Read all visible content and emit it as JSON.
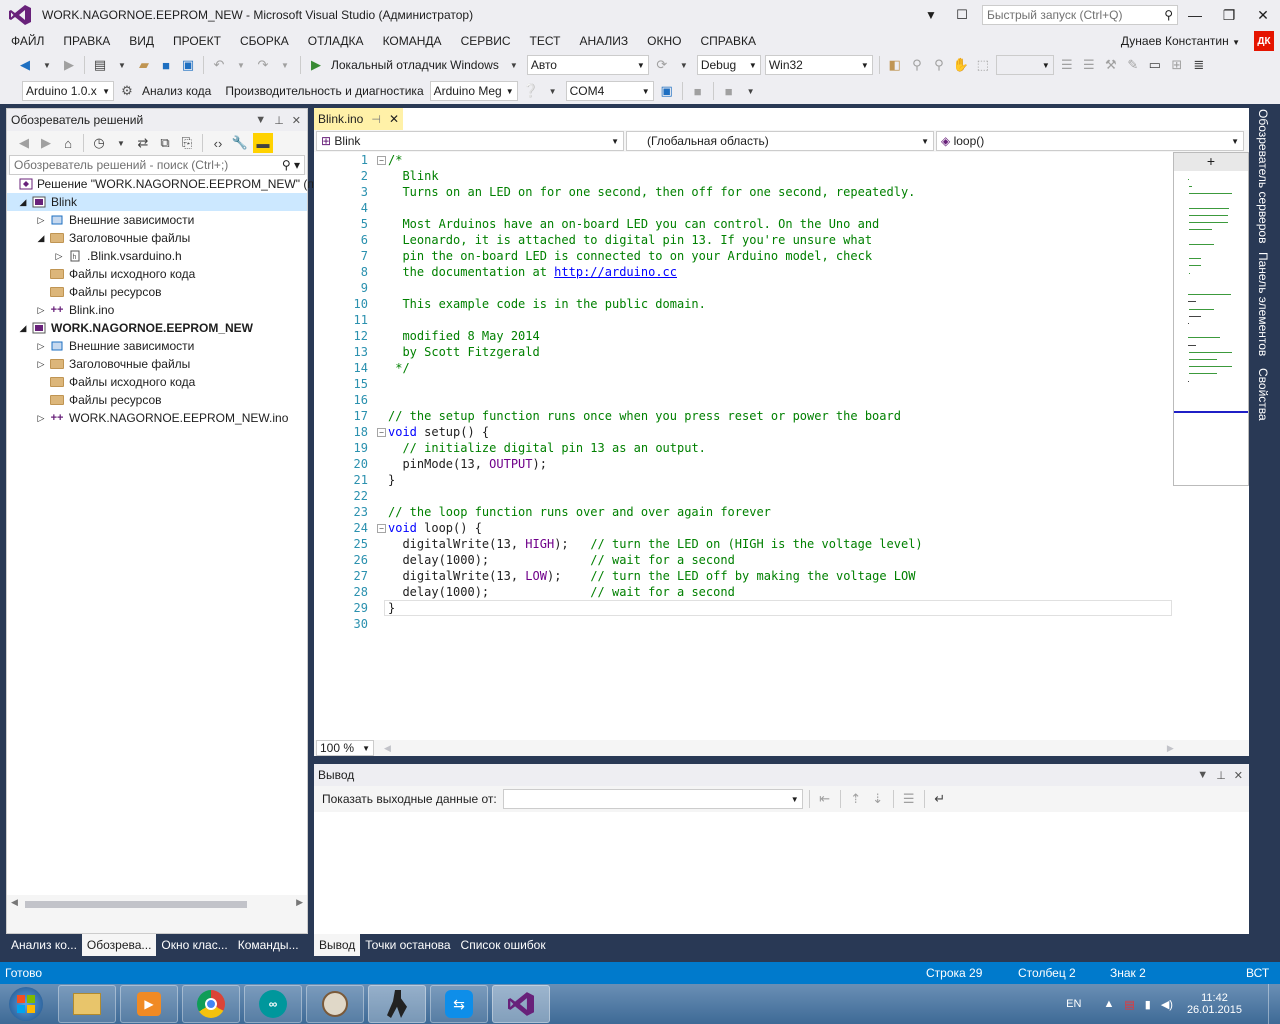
{
  "window": {
    "title": "WORK.NAGORNOE.EEPROM_NEW - Microsoft Visual Studio (Администратор)",
    "quick_launch_placeholder": "Быстрый запуск (Ctrl+Q)"
  },
  "menu": [
    "ФАЙЛ",
    "ПРАВКА",
    "ВИД",
    "ПРОЕКТ",
    "СБОРКА",
    "ОТЛАДКА",
    "КОМАНДА",
    "СЕРВИС",
    "ТЕСТ",
    "АНАЛИЗ",
    "ОКНО",
    "СПРАВКА"
  ],
  "user": {
    "name": "Дунаев Константин",
    "initials": "ДК"
  },
  "toolbar1": {
    "debugger": "Локальный отладчик Windows",
    "config_mode": "Авто",
    "configuration": "Debug",
    "platform": "Win32"
  },
  "toolbar2": {
    "arduino_version": "Arduino 1.0.x",
    "code_analysis": "Анализ кода",
    "perf_diag": "Производительность и диагностика",
    "board": "Arduino Meg",
    "port": "COM4"
  },
  "solution_explorer": {
    "title": "Обозреватель решений",
    "search_placeholder": "Обозреватель решений - поиск (Ctrl+;)",
    "tree": [
      {
        "label": "Решение \"WORK.NAGORNOE.EEPROM_NEW\"  (пр",
        "level": 0,
        "expander": "",
        "icon": "solution"
      },
      {
        "label": "Blink",
        "level": 0,
        "expander": "open",
        "icon": "project",
        "selected": true
      },
      {
        "label": "Внешние зависимости",
        "level": 1,
        "expander": "closed",
        "icon": "deps"
      },
      {
        "label": "Заголовочные файлы",
        "level": 1,
        "expander": "open",
        "icon": "folder"
      },
      {
        "label": ".Blink.vsarduino.h",
        "level": 2,
        "expander": "closed",
        "icon": "header"
      },
      {
        "label": "Файлы исходного кода",
        "level": 1,
        "expander": "",
        "icon": "folder"
      },
      {
        "label": "Файлы ресурсов",
        "level": 1,
        "expander": "",
        "icon": "folder"
      },
      {
        "label": "Blink.ino",
        "level": 1,
        "expander": "closed",
        "icon": "ino"
      },
      {
        "label": "WORK.NAGORNOE.EEPROM_NEW",
        "level": 0,
        "expander": "open",
        "icon": "project",
        "bold": true
      },
      {
        "label": "Внешние зависимости",
        "level": 1,
        "expander": "closed",
        "icon": "deps"
      },
      {
        "label": "Заголовочные файлы",
        "level": 1,
        "expander": "closed",
        "icon": "folder"
      },
      {
        "label": "Файлы исходного кода",
        "level": 1,
        "expander": "",
        "icon": "folder"
      },
      {
        "label": "Файлы ресурсов",
        "level": 1,
        "expander": "",
        "icon": "folder"
      },
      {
        "label": "WORK.NAGORNOE.EEPROM_NEW.ino",
        "level": 1,
        "expander": "closed",
        "icon": "ino"
      }
    ]
  },
  "left_bottom_tabs": [
    "Анализ ко...",
    "Обозрева...",
    "Окно клас...",
    "Команды..."
  ],
  "editor": {
    "tab": "Blink.ino",
    "nav_project": "Blink",
    "nav_scope": "(Глобальная область)",
    "nav_member": "loop()",
    "zoom": "100 %",
    "lines": [
      "/*",
      "  Blink",
      "  Turns on an LED on for one second, then off for one second, repeatedly.",
      "",
      "  Most Arduinos have an on-board LED you can control. On the Uno and",
      "  Leonardo, it is attached to digital pin 13. If you're unsure what",
      "  pin the on-board LED is connected to on your Arduino model, check",
      "  the documentation at http://arduino.cc",
      "",
      "  This example code is in the public domain.",
      "",
      "  modified 8 May 2014",
      "  by Scott Fitzgerald",
      " */",
      "",
      "",
      "// the setup function runs once when you press reset or power the board",
      "void setup() {",
      "  // initialize digital pin 13 as an output.",
      "  pinMode(13, OUTPUT);",
      "}",
      "",
      "// the loop function runs over and over again forever",
      "void loop() {",
      "  digitalWrite(13, HIGH);   // turn the LED on (HIGH is the voltage level)",
      "  delay(1000);              // wait for a second",
      "  digitalWrite(13, LOW);    // turn the LED off by making the voltage LOW",
      "  delay(1000);              // wait for a second",
      "}",
      ""
    ]
  },
  "output": {
    "title": "Вывод",
    "show_from_label": "Показать выходные данные от:",
    "show_from_value": ""
  },
  "right_bottom_tabs": [
    "Вывод",
    "Точки останова",
    "Список ошибок"
  ],
  "side_tabs": [
    "Обозреватель серверов",
    "Панель элементов",
    "Свойства"
  ],
  "status": {
    "ready": "Готово",
    "row": "Строка 29",
    "col": "Столбец 2",
    "char": "Знак 2",
    "mode": "ВСТ"
  },
  "taskbar": {
    "lang": "EN",
    "time": "11:42",
    "date": "26.01.2015"
  },
  "colors": {
    "accent": "#007acc",
    "vs_purple": "#68217a",
    "comment": "#008000",
    "keyword": "#0000ff",
    "macro": "#6f008a",
    "line_number": "#2b91af"
  }
}
